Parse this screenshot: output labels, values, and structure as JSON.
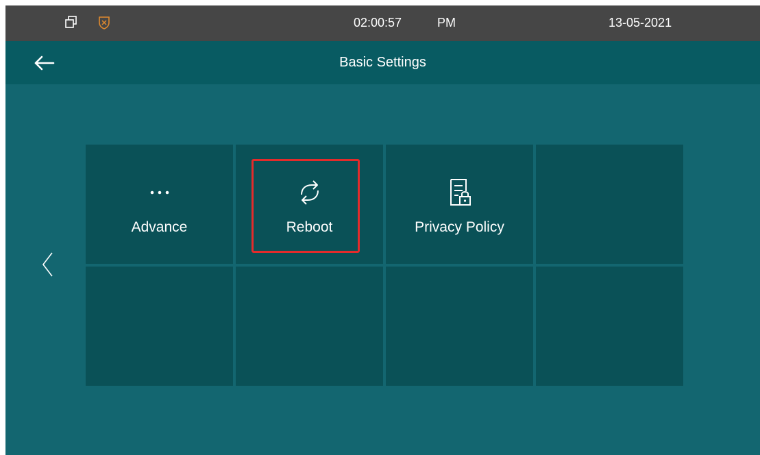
{
  "status_bar": {
    "window_icon": "multi-window-icon",
    "shield_icon": "shield-icon",
    "time": "02:00:57",
    "ampm": "PM",
    "date": "13-05-2021"
  },
  "header": {
    "back_icon": "arrow-left-icon",
    "title": "Basic Settings"
  },
  "navigation": {
    "prev_icon": "chevron-left-icon"
  },
  "tiles": [
    {
      "label": "Advance",
      "icon": "more-dots-icon"
    },
    {
      "label": "Reboot",
      "icon": "reboot-icon",
      "highlighted": true
    },
    {
      "label": "Privacy Policy",
      "icon": "privacy-document-lock-icon"
    },
    {
      "label": "",
      "icon": ""
    },
    {
      "label": "",
      "icon": ""
    },
    {
      "label": "",
      "icon": ""
    },
    {
      "label": "",
      "icon": ""
    },
    {
      "label": "",
      "icon": ""
    }
  ],
  "colors": {
    "status_bar_bg": "#464646",
    "title_bar_bg": "#085b62",
    "screen_bg": "#136670",
    "tile_bg": "#0a5157",
    "highlight": "#e42b2b",
    "shield_accent": "#e08a2e"
  }
}
